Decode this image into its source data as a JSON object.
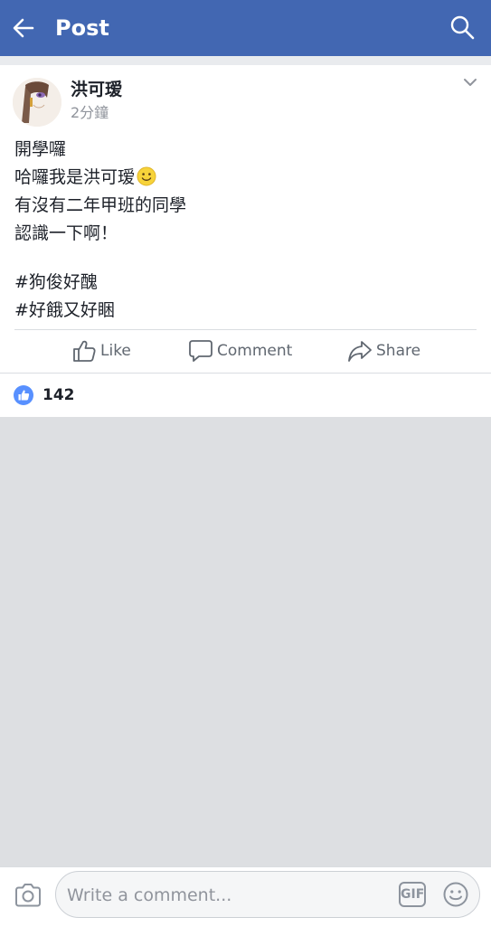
{
  "header": {
    "title": "Post",
    "back_icon": "back-arrow-icon",
    "search_icon": "search-icon",
    "background": "#4267b2"
  },
  "post": {
    "author": "洪可瑷",
    "time": "2分鐘",
    "menu_icon": "chevron-down-icon",
    "text_lines": [
      "開學囉",
      "哈囉我是洪可瑷",
      "有沒有二年甲班的同學",
      "認識一下啊！",
      "",
      "#狗俊好醜",
      "#好餓又好睏"
    ],
    "emoji": "slightly-smiling-face"
  },
  "actions": {
    "like": "Like",
    "comment": "Comment",
    "share": "Share",
    "color": "#606770"
  },
  "reactions": {
    "count": "142",
    "badge_color": "#5890ff"
  },
  "composer": {
    "placeholder": "Write a comment...",
    "gif_label": "GIF",
    "camera_icon": "camera-icon",
    "emoji_icon": "emoji-icon"
  }
}
